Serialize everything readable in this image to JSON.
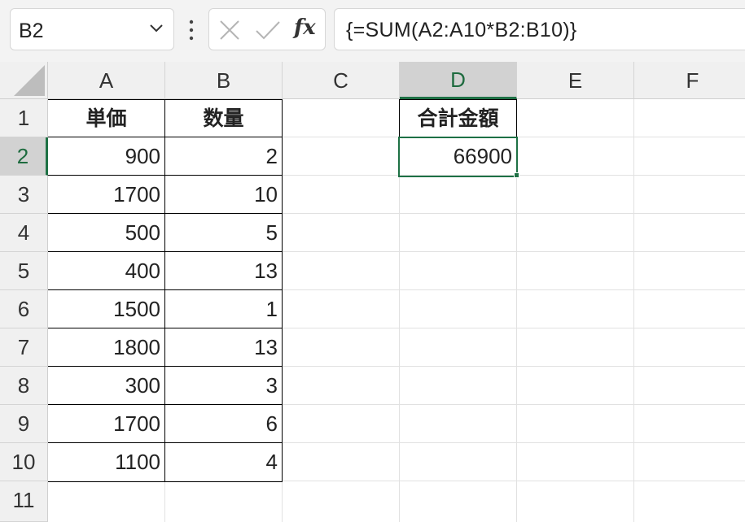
{
  "formula_bar": {
    "name_box": "B2",
    "formula": "{=SUM(A2:A10*B2:B10)}",
    "fx_label": "fx"
  },
  "columns": [
    "A",
    "B",
    "C",
    "D",
    "E",
    "F"
  ],
  "rows": [
    "1",
    "2",
    "3",
    "4",
    "5",
    "6",
    "7",
    "8",
    "9",
    "10",
    "11"
  ],
  "table": {
    "headers": {
      "A": "単価",
      "B": "数量"
    },
    "unit_price": [
      "900",
      "1700",
      "500",
      "400",
      "1500",
      "1800",
      "300",
      "1700",
      "1100"
    ],
    "quantity": [
      "2",
      "10",
      "5",
      "13",
      "1",
      "13",
      "3",
      "6",
      "4"
    ]
  },
  "total": {
    "header": "合計金額",
    "value": "66900"
  },
  "colors": {
    "selection_accent": "#1e7145",
    "header_bg": "#f0f0f0",
    "selected_header_bg": "#d2d2d2"
  }
}
